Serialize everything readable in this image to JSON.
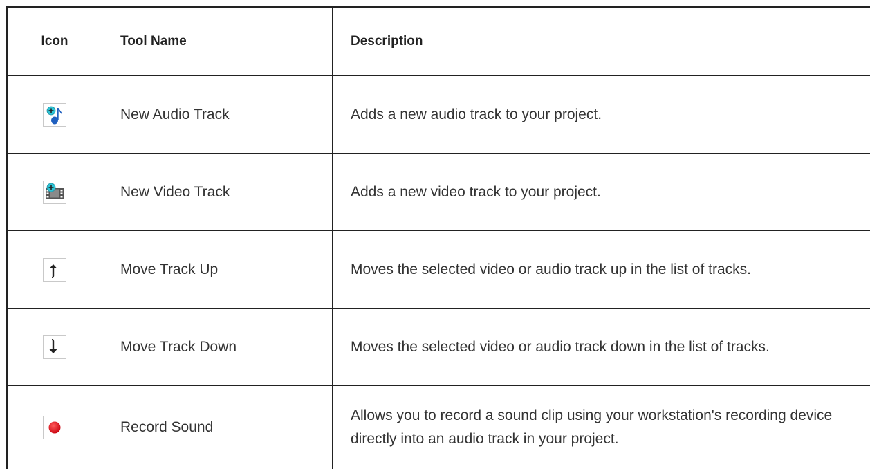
{
  "table": {
    "headers": {
      "icon": "Icon",
      "tool_name": "Tool Name",
      "description": "Description"
    },
    "rows": [
      {
        "icon": "new-audio-track-icon",
        "tool_name": "New Audio Track",
        "description": "Adds a new audio track to your project."
      },
      {
        "icon": "new-video-track-icon",
        "tool_name": "New Video Track",
        "description": "Adds a new video track to your project."
      },
      {
        "icon": "move-track-up-icon",
        "tool_name": "Move Track Up",
        "description": "Moves the selected video or audio track up in the list of tracks."
      },
      {
        "icon": "move-track-down-icon",
        "tool_name": "Move Track Down",
        "description": "Moves the selected video or audio track down in the list of tracks."
      },
      {
        "icon": "record-sound-icon",
        "tool_name": "Record Sound",
        "description": "Allows you to record a sound clip using your workstation's recording device directly into an audio track in your project."
      }
    ]
  },
  "colors": {
    "border": "#222222",
    "text": "#333333",
    "icon_blue": "#1f5fbf",
    "icon_cyan": "#2ec4d6",
    "record_red": "#e0101a"
  }
}
